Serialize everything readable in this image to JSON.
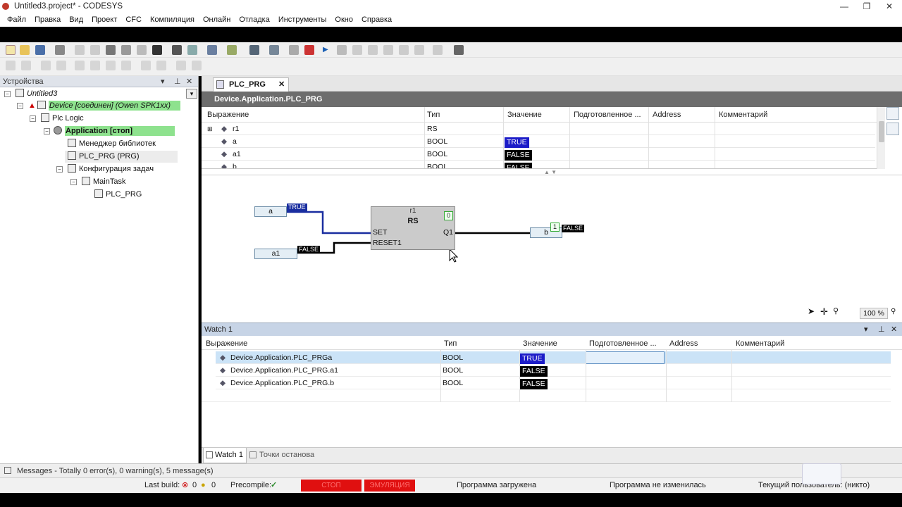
{
  "window": {
    "title": "Untitled3.project* - CODESYS",
    "min": "—",
    "max": "❐",
    "close": "✕"
  },
  "menu": [
    "Файл",
    "Правка",
    "Вид",
    "Проект",
    "CFC",
    "Компиляция",
    "Онлайн",
    "Отладка",
    "Инструменты",
    "Окно",
    "Справка"
  ],
  "devices": {
    "title": "Устройства",
    "tree": [
      {
        "label": "Untitled3"
      },
      {
        "label": "Device [соединен] (Owen SPK1xx)"
      },
      {
        "label": "Plc Logic"
      },
      {
        "label": "Application [стоп]"
      },
      {
        "label": "Менеджер библиотек"
      },
      {
        "label": "PLC_PRG (PRG)"
      },
      {
        "label": "Конфигурация задач"
      },
      {
        "label": "MainTask"
      },
      {
        "label": "PLC_PRG"
      }
    ]
  },
  "editor": {
    "tab": "PLC_PRG",
    "path": "Device.Application.PLC_PRG",
    "columns": [
      "Выражение",
      "Тип",
      "Значение",
      "Подготовленное ...",
      "Address",
      "Комментарий"
    ],
    "rows": [
      {
        "expr": "r1",
        "type": "RS",
        "value": ""
      },
      {
        "expr": "a",
        "type": "BOOL",
        "value": "TRUE"
      },
      {
        "expr": "a1",
        "type": "BOOL",
        "value": "FALSE"
      },
      {
        "expr": "b",
        "type": "BOOL",
        "value": "FALSE"
      }
    ],
    "zoom": "100 %"
  },
  "cfc": {
    "input_a": "a",
    "input_a_val": "TRUE",
    "input_a1": "a1",
    "input_a1_val": "FALSE",
    "block_instance": "r1",
    "block_type": "RS",
    "block_order": "0",
    "pin_set": "SET",
    "pin_reset": "RESET1",
    "pin_q1": "Q1",
    "output_b": "b",
    "output_order": "1",
    "output_b_val": "FALSE"
  },
  "watch": {
    "title": "Watch 1",
    "columns": [
      "Выражение",
      "Тип",
      "Значение",
      "Подготовленное ...",
      "Address",
      "Комментарий"
    ],
    "rows": [
      {
        "expr": "Device.Application.PLC_PRGa",
        "type": "BOOL",
        "value": "TRUE"
      },
      {
        "expr": "Device.Application.PLC_PRG.a1",
        "type": "BOOL",
        "value": "FALSE"
      },
      {
        "expr": "Device.Application.PLC_PRG.b",
        "type": "BOOL",
        "value": "FALSE"
      }
    ],
    "tabs": [
      "Watch 1",
      "Точки останова"
    ]
  },
  "messages": "Messages - Totally 0 error(s), 0 warning(s), 5 message(s)",
  "status": {
    "last_build_label": "Last build:",
    "errors": "0",
    "warnings": "0",
    "precompile_label": "Precompile:",
    "stop": "СТОП",
    "emulation": "ЭМУЛЯЦИЯ",
    "program_loaded": "Программа загружена",
    "program_unchanged": "Программа не изменилась",
    "current_user": "Текущий пользователь: (никто)"
  },
  "colors": {
    "true_bg": "#1c1cc8",
    "false_bg": "#000000",
    "highlight_green": "#8ee28e",
    "stop_red": "#e01010"
  }
}
